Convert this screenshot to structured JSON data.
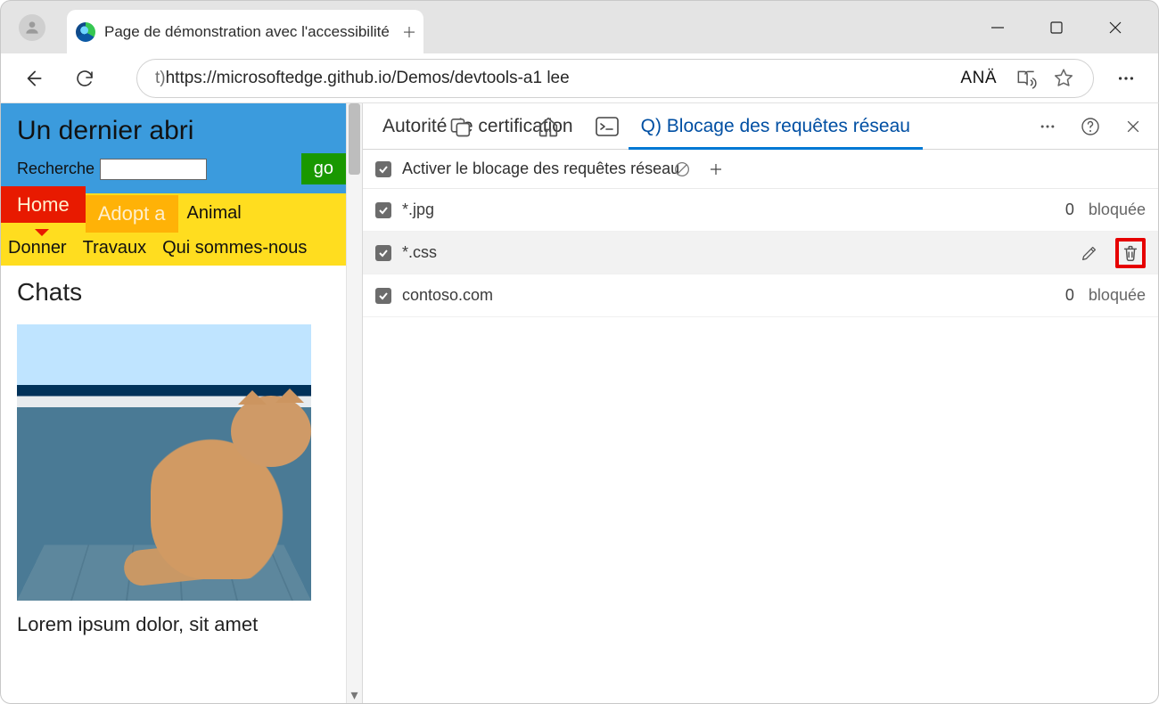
{
  "window": {
    "tab_title": "Page de démonstration avec l'accessibilité"
  },
  "toolbar": {
    "url_prefix": "t) ",
    "url_main": "https://microsoftedge.github.io/Demos/devtools-a1 lee",
    "ana_label": "ANÄ"
  },
  "page": {
    "site_title": "Un dernier abri",
    "search_label": "Recherche",
    "go_label": "go",
    "nav": {
      "home": "Home",
      "adopt": "Adopt a",
      "animal": "Animal",
      "donate": "Donner",
      "jobs": "Travaux",
      "about": "Qui sommes-nous"
    },
    "section_heading": "Chats",
    "lorem": "Lorem ipsum dolor, sit amet"
  },
  "devtools": {
    "tabs": {
      "authority": "Autorité de certification",
      "blocking": "Q) Blocage des requêtes réseau"
    },
    "enable_label": "Activer le blocage des requêtes réseau",
    "patterns": [
      {
        "text": "*.jpg",
        "count": "0",
        "blocked_label": "bloquée",
        "hover": false,
        "show_count": true
      },
      {
        "text": "*.css",
        "count": "",
        "blocked_label": "",
        "hover": true,
        "show_count": false
      },
      {
        "text": "contoso.com",
        "count": "0",
        "blocked_label": "bloquée",
        "hover": false,
        "show_count": true
      }
    ]
  }
}
